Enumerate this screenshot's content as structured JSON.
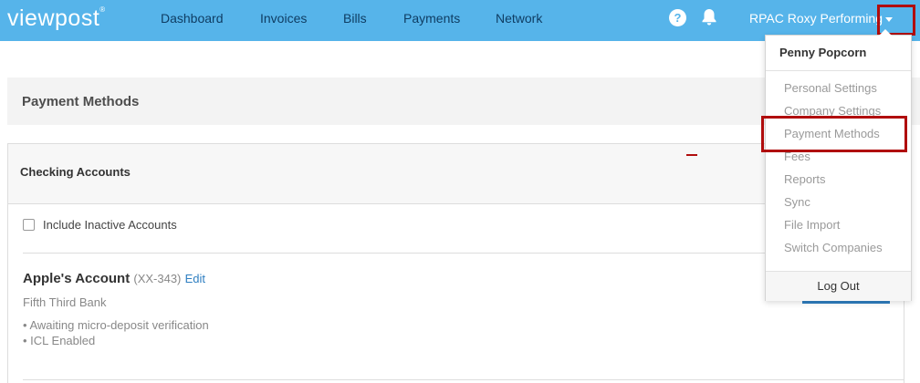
{
  "brand": {
    "logo": "viewpost",
    "trademark": "®"
  },
  "nav": {
    "items": [
      "Dashboard",
      "Invoices",
      "Bills",
      "Payments",
      "Network"
    ],
    "help_icon": "question-circle-icon",
    "bell_icon": "bell-icon",
    "account_name": "RPAC Roxy Performing ...",
    "caret_icon": "caret-down-icon"
  },
  "colors": {
    "topbar": "#56b4ea",
    "highlight": "#b00d0d",
    "link": "#2f7fc1"
  },
  "page": {
    "title": "Payment Methods"
  },
  "checking": {
    "title": "Checking Accounts",
    "include_inactive_label": "Include Inactive Accounts",
    "include_inactive_checked": false,
    "account": {
      "name": "Apple's Account",
      "mask": "(XX-343)",
      "edit_label": "Edit",
      "bank": "Fifth Third Bank",
      "notes": [
        "• Awaiting micro-deposit verification",
        "• ICL Enabled"
      ]
    }
  },
  "dropdown": {
    "user": "Penny Popcorn",
    "items": [
      "Personal Settings",
      "Company Settings",
      "Payment Methods",
      "Fees",
      "Reports",
      "Sync",
      "File Import",
      "Switch Companies"
    ],
    "logout": "Log Out"
  }
}
